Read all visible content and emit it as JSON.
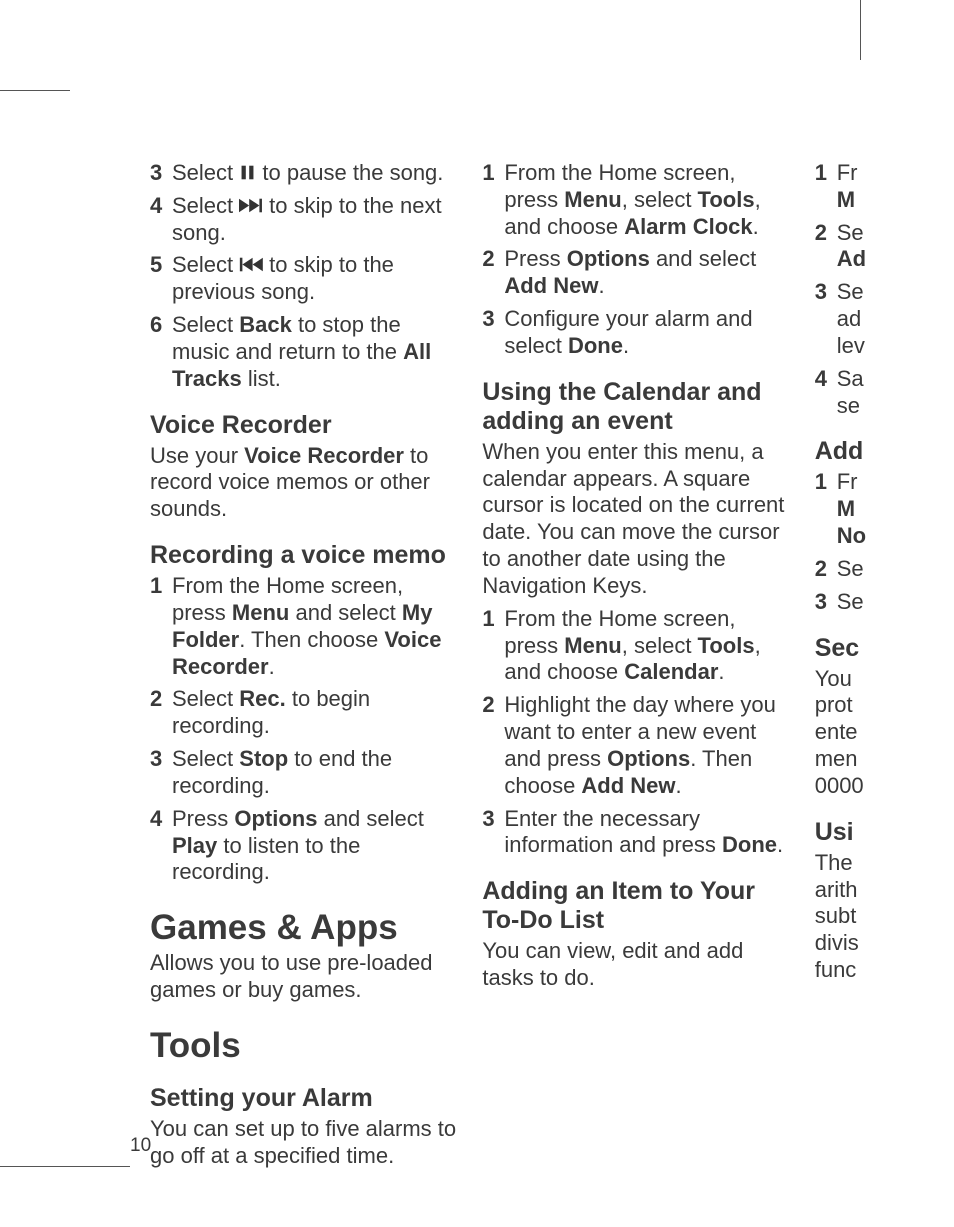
{
  "page_number": "10",
  "col1": {
    "steps_a": [
      {
        "num": "3",
        "pre": "Select ",
        "icon": "pause-icon",
        "post": " to pause the song."
      },
      {
        "num": "4",
        "pre": "Select ",
        "icon": "next-icon",
        "post": " to skip to the next song."
      },
      {
        "num": "5",
        "pre": "Select ",
        "icon": "prev-icon",
        "post": " to skip to the previous song."
      },
      {
        "num": "6",
        "pre": "Select ",
        "bold1": "Back",
        "mid": " to stop the music and return to the ",
        "bold2": "All Tracks",
        "post": " list."
      }
    ],
    "h_voice": "Voice Recorder",
    "p_voice_pre": "Use your ",
    "p_voice_bold": "Voice Recorder",
    "p_voice_post": " to record voice memos or other sounds.",
    "h_record": "Recording a voice memo",
    "steps_b": [
      {
        "num": "1",
        "parts": [
          {
            "t": "From the Home screen, press "
          },
          {
            "t": "Menu",
            "b": true
          },
          {
            "t": " and select "
          },
          {
            "t": "My Folder",
            "b": true
          },
          {
            "t": ". Then choose "
          },
          {
            "t": "Voice Recorder",
            "b": true
          },
          {
            "t": "."
          }
        ]
      },
      {
        "num": "2",
        "parts": [
          {
            "t": "Select "
          },
          {
            "t": "Rec.",
            "b": true
          },
          {
            "t": " to begin recording."
          }
        ]
      },
      {
        "num": "3",
        "parts": [
          {
            "t": "Select "
          },
          {
            "t": "Stop",
            "b": true
          },
          {
            "t": " to end the recording."
          }
        ]
      },
      {
        "num": "4",
        "parts": [
          {
            "t": "Press "
          },
          {
            "t": "Options",
            "b": true
          },
          {
            "t": " and select "
          },
          {
            "t": "Play",
            "b": true
          },
          {
            "t": " to listen to the recording."
          }
        ]
      }
    ],
    "h_games": "Games & Apps",
    "p_games": "Allows you to use pre-loaded games or buy games.",
    "h_tools": "Tools",
    "h_alarm": "Setting your Alarm",
    "p_alarm": "You can set up to five alarms to go off at a specified time."
  },
  "col2": {
    "steps_a": [
      {
        "num": "1",
        "parts": [
          {
            "t": "From the Home screen, press "
          },
          {
            "t": "Menu",
            "b": true
          },
          {
            "t": ", select "
          },
          {
            "t": "Tools",
            "b": true
          },
          {
            "t": ", and choose "
          },
          {
            "t": "Alarm Clock",
            "b": true
          },
          {
            "t": "."
          }
        ]
      },
      {
        "num": "2",
        "parts": [
          {
            "t": "Press "
          },
          {
            "t": "Options",
            "b": true
          },
          {
            "t": " and select "
          },
          {
            "t": "Add New",
            "b": true
          },
          {
            "t": "."
          }
        ]
      },
      {
        "num": "3",
        "parts": [
          {
            "t": "Configure your alarm and select "
          },
          {
            "t": "Done",
            "b": true
          },
          {
            "t": "."
          }
        ]
      }
    ],
    "h_cal": "Using the Calendar and adding an event",
    "p_cal": "When you enter this menu, a calendar appears. A square cursor is located on the current date. You can move the cursor to another date using the Navigation Keys.",
    "steps_b": [
      {
        "num": "1",
        "parts": [
          {
            "t": "From the Home screen, press "
          },
          {
            "t": "Menu",
            "b": true
          },
          {
            "t": ", select "
          },
          {
            "t": "Tools",
            "b": true
          },
          {
            "t": ", and choose "
          },
          {
            "t": "Calendar",
            "b": true
          },
          {
            "t": "."
          }
        ]
      },
      {
        "num": "2",
        "parts": [
          {
            "t": "Highlight the day where you want to enter a new event and press "
          },
          {
            "t": "Options",
            "b": true
          },
          {
            "t": ". Then choose "
          },
          {
            "t": "Add New",
            "b": true
          },
          {
            "t": "."
          }
        ]
      },
      {
        "num": "3",
        "parts": [
          {
            "t": "Enter the necessary information and press "
          },
          {
            "t": "Done",
            "b": true
          },
          {
            "t": "."
          }
        ]
      }
    ],
    "h_todo": "Adding an Item to Your To-Do List",
    "p_todo": "You can view, edit and add tasks to do."
  },
  "col3": {
    "steps_a": [
      {
        "num": "1",
        "parts": [
          {
            "t": "Fr"
          },
          {
            "t": "M",
            "b": true
          }
        ],
        "lines": 2
      },
      {
        "num": "2",
        "parts": [
          {
            "t": "Se"
          },
          {
            "t": "Ad",
            "b": true
          }
        ],
        "lines": 2
      },
      {
        "num": "3",
        "parts": [
          {
            "t": "Se"
          },
          {
            "t": "ad"
          },
          {
            "t": "lev"
          }
        ],
        "lines": 3
      },
      {
        "num": "4",
        "parts": [
          {
            "t": "Sa"
          },
          {
            "t": "se"
          }
        ],
        "lines": 2
      }
    ],
    "h_add": "Add",
    "steps_b": [
      {
        "num": "1",
        "parts": [
          {
            "t": "Fr"
          },
          {
            "t": "M",
            "b": true
          },
          {
            "t": "No",
            "b": true
          }
        ],
        "lines": 3
      },
      {
        "num": "2",
        "parts": [
          {
            "t": "Se"
          }
        ],
        "lines": 1
      },
      {
        "num": "3",
        "parts": [
          {
            "t": "Se"
          }
        ],
        "lines": 1
      }
    ],
    "h_sec": "Sec",
    "p_sec": [
      "You ",
      "prot",
      "ente",
      "men",
      "0000"
    ],
    "h_usi": "Usi",
    "p_usi": [
      "The ",
      "arith",
      "subt",
      "divis",
      "func"
    ]
  }
}
